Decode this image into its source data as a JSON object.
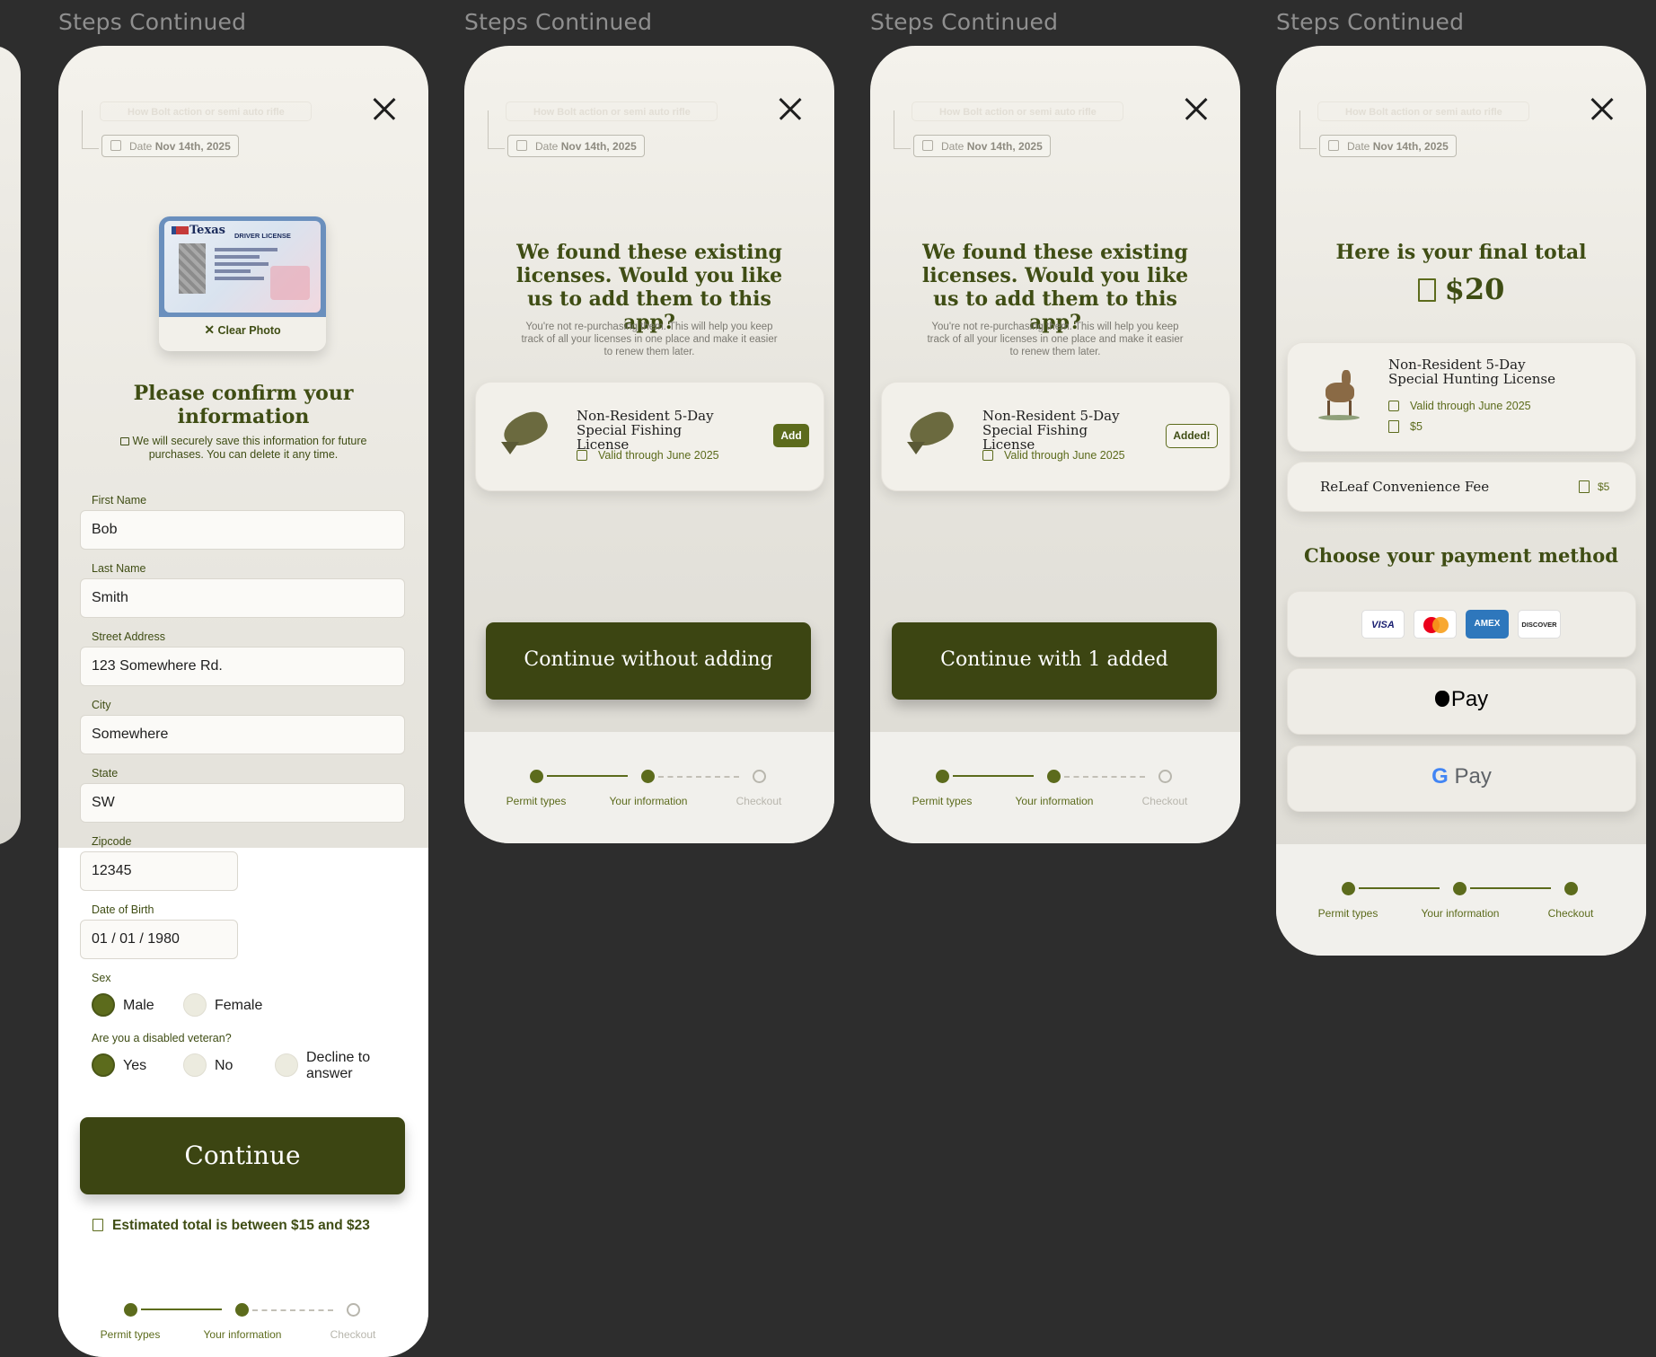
{
  "section_label": "Steps Continued",
  "shared": {
    "ghost_chip": "How Bolt action or semi auto rifle",
    "date_prefix": "Date",
    "date_value": "Nov 14th, 2025",
    "steps": [
      "Permit types",
      "Your information",
      "Checkout"
    ]
  },
  "screen1": {
    "clear_photo": "Clear Photo",
    "heading": "Please confirm your information",
    "privacy_note": "We will securely save this information for future purchases. You can delete it any time.",
    "fields": {
      "first_name": {
        "label": "First Name",
        "value": "Bob"
      },
      "last_name": {
        "label": "Last Name",
        "value": "Smith"
      },
      "street": {
        "label": "Street Address",
        "value": "123 Somewhere Rd."
      },
      "city": {
        "label": "City",
        "value": "Somewhere"
      },
      "state": {
        "label": "State",
        "value": "SW"
      },
      "zip": {
        "label": "Zipcode",
        "value": "12345"
      },
      "dob": {
        "label": "Date of Birth",
        "value": "01 / 01 / 1980"
      }
    },
    "sex": {
      "label": "Sex",
      "options": [
        "Male",
        "Female"
      ],
      "selected": "Male"
    },
    "veteran": {
      "label": "Are you a disabled veteran?",
      "options": [
        "Yes",
        "No",
        "Decline to answer"
      ],
      "selected": "Yes"
    },
    "continue": "Continue",
    "estimate": "Estimated total is between $15 and $23",
    "license_card": {
      "state": "Texas",
      "title": "DRIVER LICENSE"
    }
  },
  "screen2": {
    "heading": "We found these existing licenses. Would you like us to add them to this app?",
    "sub": "You're not re-purchasing them. This will help you keep track of all your licenses in one place and make it easier to renew them later.",
    "license_title": "Non-Resident 5-Day Special Fishing License",
    "valid": "Valid through June 2025",
    "add_button": "Add",
    "continue": "Continue without adding"
  },
  "screen3": {
    "heading": "We found these existing licenses. Would you like us to add them to this app?",
    "sub": "You're not re-purchasing them. This will help you keep track of all your licenses in one place and make it easier to renew them later.",
    "license_title": "Non-Resident 5-Day Special Fishing License",
    "valid": "Valid through June 2025",
    "added_button": "Added!",
    "continue": "Continue with 1 added"
  },
  "screen4": {
    "heading": "Here is your final total",
    "total": "$20",
    "license_title": "Non-Resident 5-Day Special Hunting License",
    "valid": "Valid through June 2025",
    "price": "$5",
    "fee_label": "ReLeaf Convenience Fee",
    "fee_price": "$5",
    "payment_heading": "Choose your payment method",
    "cards": [
      "VISA",
      "AMEX",
      "DISCOVER"
    ],
    "apple_pay": "Pay",
    "google_pay": "Pay"
  },
  "colors": {
    "accent": "#3c4512",
    "accent_light": "#5c6b1c",
    "background": "#2d2d2d"
  }
}
